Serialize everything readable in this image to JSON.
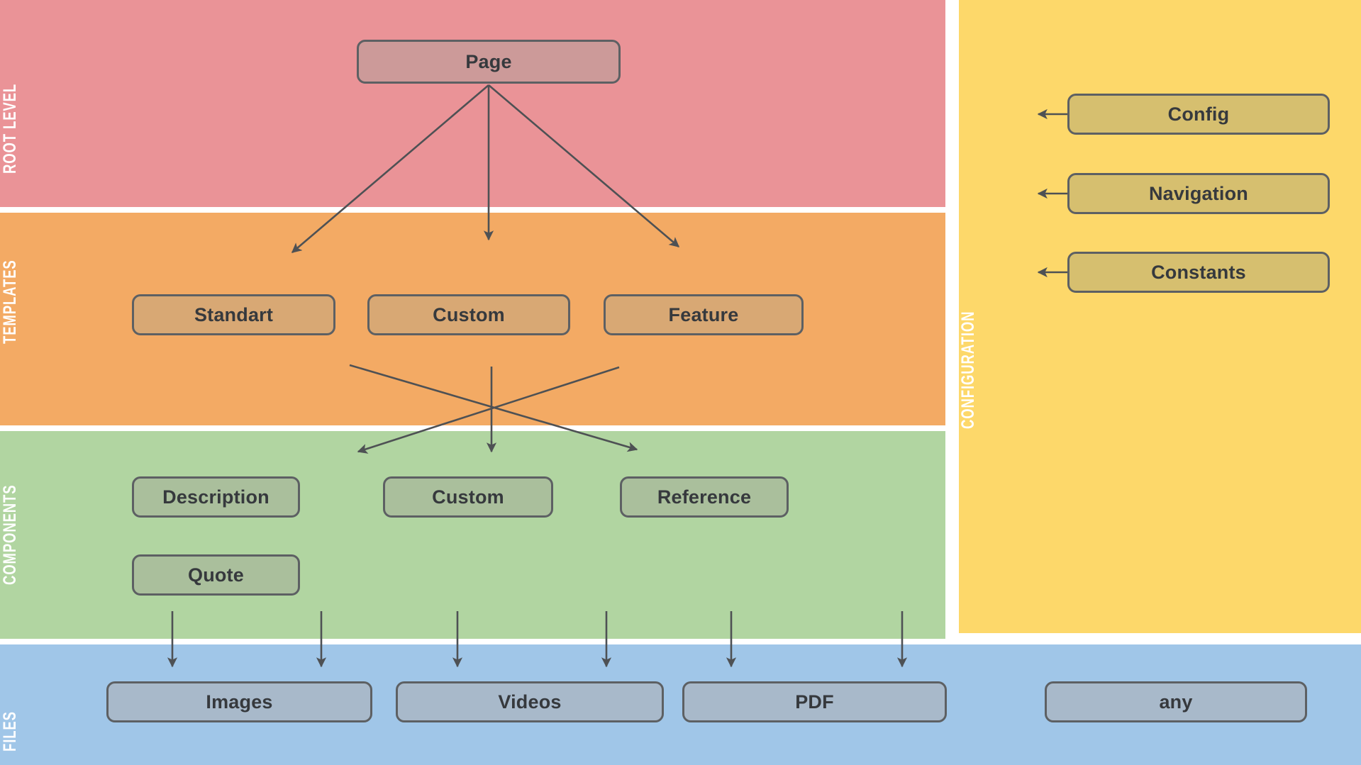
{
  "bands": [
    {
      "id": "root",
      "label": "ROOT LEVEL",
      "color": "#ea9397"
    },
    {
      "id": "templates",
      "label": "TEMPLATES",
      "color": "#f3aa64"
    },
    {
      "id": "components",
      "label": "COMPONENTS",
      "color": "#b1d5a1"
    },
    {
      "id": "files",
      "label": "FILES",
      "color": "#a0c6e8"
    },
    {
      "id": "config",
      "label": "CONFIGURATION",
      "color": "#fdd86a"
    }
  ],
  "root": {
    "nodes": [
      {
        "label": "Page"
      }
    ]
  },
  "templates": {
    "nodes": [
      {
        "label": "Standart"
      },
      {
        "label": "Custom"
      },
      {
        "label": "Feature"
      }
    ]
  },
  "components": {
    "nodes": [
      {
        "label": "Description"
      },
      {
        "label": "Custom"
      },
      {
        "label": "Reference"
      },
      {
        "label": "Quote"
      }
    ]
  },
  "files": {
    "nodes": [
      {
        "label": "Images"
      },
      {
        "label": "Videos"
      },
      {
        "label": "PDF"
      },
      {
        "label": "any"
      }
    ]
  },
  "configuration": {
    "nodes": [
      {
        "label": "Config"
      },
      {
        "label": "Navigation"
      },
      {
        "label": "Constants"
      }
    ]
  },
  "style": {
    "node_border": "#5d6063",
    "node_text": "#36393d",
    "arrow_color": "#4e5154",
    "caption_text": "#ffffff",
    "page_background": "#ffffff"
  }
}
